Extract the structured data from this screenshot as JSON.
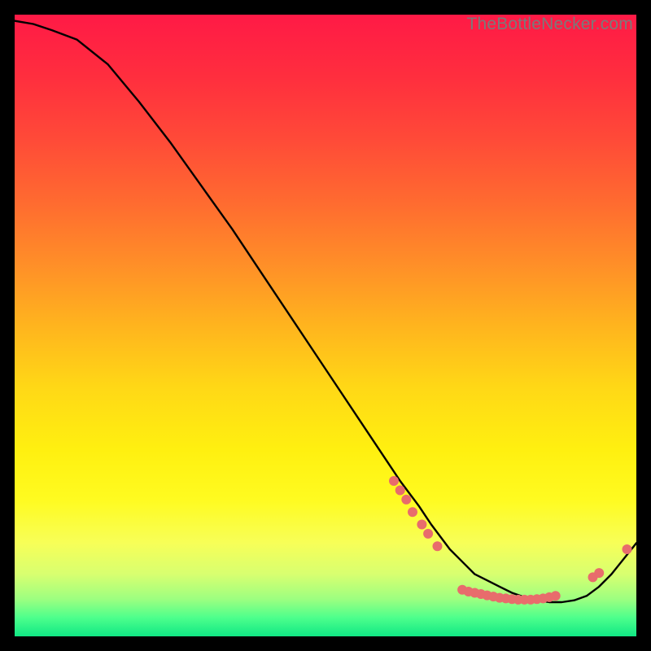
{
  "watermark": "TheBottleNecker.com",
  "chart_data": {
    "type": "line",
    "title": "",
    "xlabel": "",
    "ylabel": "",
    "xlim": [
      0,
      100
    ],
    "ylim": [
      0,
      100
    ],
    "grid": false,
    "series": [
      {
        "name": "curve",
        "x": [
          0,
          3,
          6,
          10,
          15,
          20,
          25,
          30,
          35,
          40,
          45,
          50,
          55,
          60,
          62,
          65,
          67,
          70,
          72,
          74,
          76,
          78,
          80,
          82,
          84,
          86,
          88,
          90,
          92,
          94,
          96,
          100
        ],
        "values": [
          99,
          98.5,
          97.5,
          96,
          92,
          86,
          79.5,
          72.5,
          65.5,
          58,
          50.5,
          43,
          35.5,
          28,
          25,
          21,
          18,
          14,
          12,
          10,
          9,
          8,
          7,
          6.3,
          5.8,
          5.5,
          5.5,
          5.8,
          6.5,
          8,
          10,
          15
        ]
      }
    ],
    "dots": {
      "name": "dots",
      "color": "#e86c6c",
      "radius": 6,
      "points": [
        {
          "x": 61,
          "y": 25
        },
        {
          "x": 62,
          "y": 23.5
        },
        {
          "x": 63,
          "y": 22
        },
        {
          "x": 64,
          "y": 20
        },
        {
          "x": 65.5,
          "y": 18
        },
        {
          "x": 66.5,
          "y": 16.5
        },
        {
          "x": 68,
          "y": 14.5
        },
        {
          "x": 72,
          "y": 7.5
        },
        {
          "x": 73,
          "y": 7.2
        },
        {
          "x": 74,
          "y": 7.0
        },
        {
          "x": 75,
          "y": 6.8
        },
        {
          "x": 76,
          "y": 6.6
        },
        {
          "x": 77,
          "y": 6.4
        },
        {
          "x": 78,
          "y": 6.2
        },
        {
          "x": 79,
          "y": 6.1
        },
        {
          "x": 80,
          "y": 6.0
        },
        {
          "x": 81,
          "y": 5.9
        },
        {
          "x": 82,
          "y": 5.9
        },
        {
          "x": 83,
          "y": 5.9
        },
        {
          "x": 84,
          "y": 6.0
        },
        {
          "x": 85,
          "y": 6.1
        },
        {
          "x": 86,
          "y": 6.3
        },
        {
          "x": 87,
          "y": 6.5
        },
        {
          "x": 93,
          "y": 9.5
        },
        {
          "x": 94,
          "y": 10.2
        },
        {
          "x": 98.5,
          "y": 14
        }
      ]
    },
    "gradient": {
      "stops": [
        {
          "offset": 0.0,
          "color": "#ff1a46"
        },
        {
          "offset": 0.1,
          "color": "#ff2e3e"
        },
        {
          "offset": 0.2,
          "color": "#ff4a38"
        },
        {
          "offset": 0.3,
          "color": "#ff6a30"
        },
        {
          "offset": 0.4,
          "color": "#ff8e28"
        },
        {
          "offset": 0.5,
          "color": "#ffb41e"
        },
        {
          "offset": 0.6,
          "color": "#ffd816"
        },
        {
          "offset": 0.7,
          "color": "#fff010"
        },
        {
          "offset": 0.78,
          "color": "#fffb20"
        },
        {
          "offset": 0.85,
          "color": "#f7ff58"
        },
        {
          "offset": 0.9,
          "color": "#d8ff70"
        },
        {
          "offset": 0.94,
          "color": "#9dff80"
        },
        {
          "offset": 0.97,
          "color": "#4dff8c"
        },
        {
          "offset": 1.0,
          "color": "#10e884"
        }
      ]
    }
  }
}
